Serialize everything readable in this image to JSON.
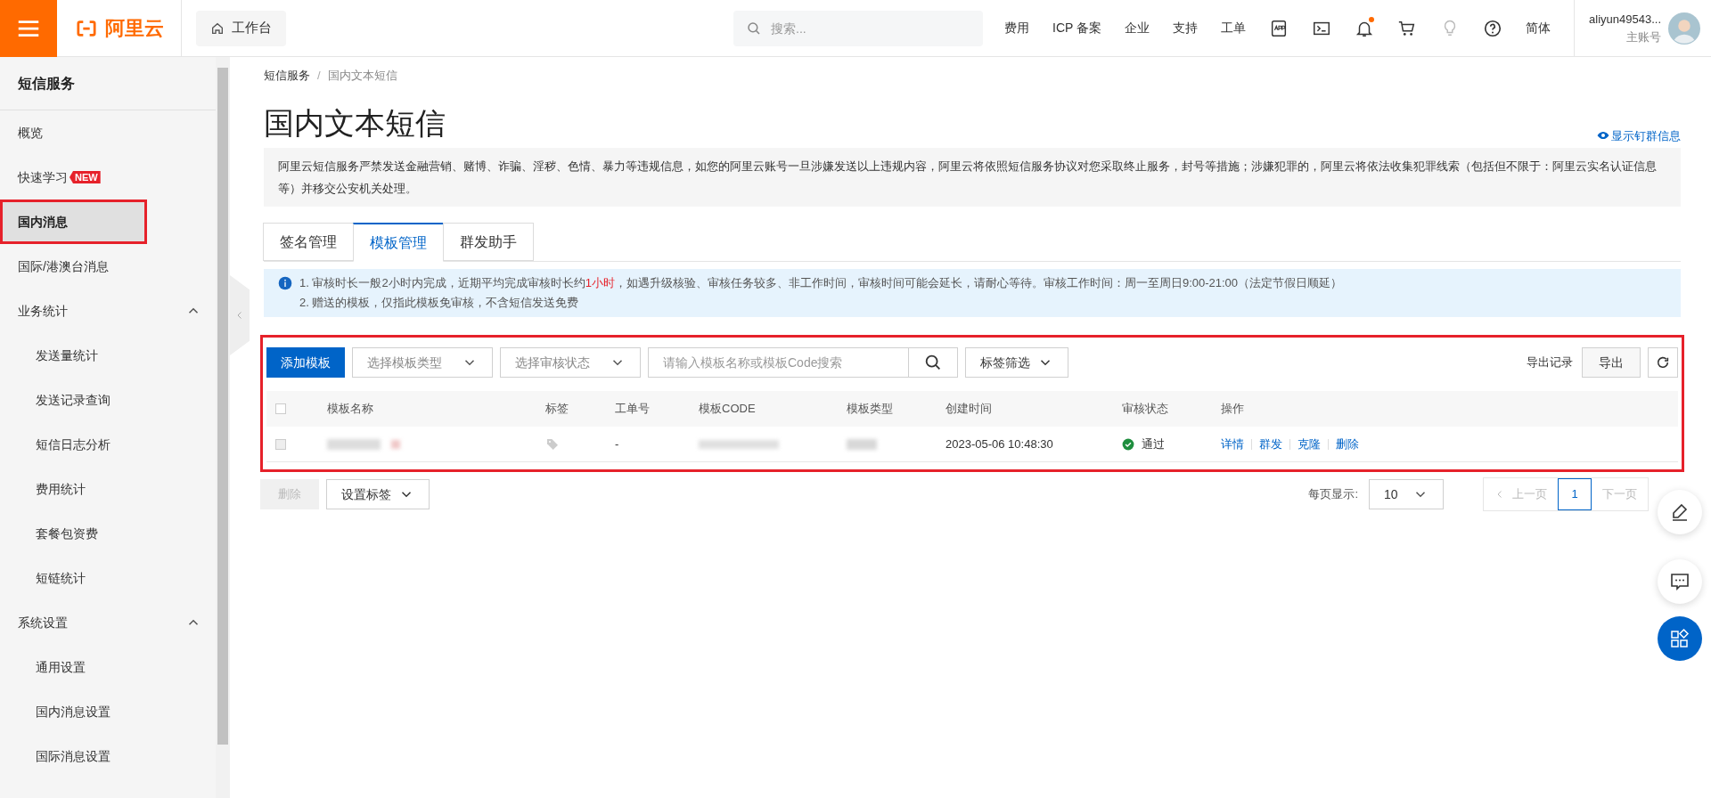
{
  "topbar": {
    "logo_text": "阿里云",
    "workbench": "工作台",
    "search_placeholder": "搜索...",
    "links": [
      "费用",
      "ICP 备案",
      "企业",
      "支持",
      "工单"
    ],
    "language": "简体",
    "notification_dot": true,
    "username": "aliyun49543...",
    "account_type": "主账号"
  },
  "sidebar": {
    "title": "短信服务",
    "items": [
      {
        "label": "概览",
        "selected": false
      },
      {
        "label": "快速学习",
        "badge": "NEW",
        "selected": false
      },
      {
        "label": "国内消息",
        "selected": true,
        "highlighted": true
      },
      {
        "label": "国际/港澳台消息",
        "selected": false
      },
      {
        "label": "业务统计",
        "selected": false,
        "expanded": true,
        "children": [
          {
            "label": "发送量统计",
            "selected": false
          },
          {
            "label": "发送记录查询",
            "selected": false
          },
          {
            "label": "短信日志分析",
            "selected": false
          },
          {
            "label": "费用统计",
            "selected": false
          },
          {
            "label": "套餐包资费",
            "selected": false
          },
          {
            "label": "短链统计",
            "selected": false
          }
        ]
      },
      {
        "label": "系统设置",
        "selected": false,
        "expanded": true,
        "children": [
          {
            "label": "通用设置",
            "selected": false
          },
          {
            "label": "国内消息设置",
            "selected": false
          },
          {
            "label": "国际消息设置",
            "selected": false
          }
        ]
      }
    ]
  },
  "breadcrumb": [
    "短信服务",
    "国内文本短信"
  ],
  "breadcrumb_separator": "/",
  "page_title": "国内文本短信",
  "show_info_link": "显示钉群信息",
  "notice": "阿里云短信服务严禁发送金融营销、赌博、诈骗、淫秽、色情、暴力等违规信息，如您的阿里云账号一旦涉嫌发送以上违规内容，阿里云将依照短信服务协议对您采取终止服务，封号等措施；涉嫌犯罪的，阿里云将依法收集犯罪线索（包括但不限于：阿里云实名认证信息等）并移交公安机关处理。",
  "tabs": [
    {
      "label": "签名管理",
      "selected": false
    },
    {
      "label": "模板管理",
      "selected": true
    },
    {
      "label": "群发助手",
      "selected": false
    }
  ],
  "info_lines": [
    {
      "parts": [
        {
          "text": "1. 审核时长一般2小时内完成，近期平均完成审核时长约",
          "highlight": false
        },
        {
          "text": "1小时",
          "highlight": true
        },
        {
          "text": "，如遇升级核验、审核任务较多、非工作时间，审核时间可能会延长，请耐心等待。审核工作时间：周一至周日9:00-21:00（法定节假日顺延）",
          "highlight": false
        }
      ]
    },
    {
      "parts": [
        {
          "text": "2. 赠送的模板，仅指此模板免审核，不含短信发送免费",
          "highlight": false
        }
      ]
    }
  ],
  "toolbar": {
    "add_button": "添加模板",
    "type_select": "选择模板类型",
    "status_select": "选择审核状态",
    "search_placeholder": "请输入模板名称或模板Code搜索",
    "tag_filter": "标签筛选",
    "export_records": "导出记录",
    "export_button": "导出"
  },
  "table": {
    "highlighted": true,
    "columns": [
      "模板名称",
      "标签",
      "工单号",
      "模板CODE",
      "模板类型",
      "创建时间",
      "审核状态",
      "操作"
    ],
    "rows": [
      {
        "checked": false,
        "ticket": "-",
        "created": "2023-05-06 10:48:30",
        "status": "通过",
        "actions": [
          "详情",
          "群发",
          "克隆",
          "删除"
        ]
      }
    ]
  },
  "footer": {
    "delete_button": "删除",
    "set_tag_button": "设置标签",
    "per_page_label": "每页显示:",
    "per_page": "10",
    "prev": "上一页",
    "pages": [
      {
        "label": "1",
        "selected": true
      }
    ],
    "next": "下一页"
  }
}
